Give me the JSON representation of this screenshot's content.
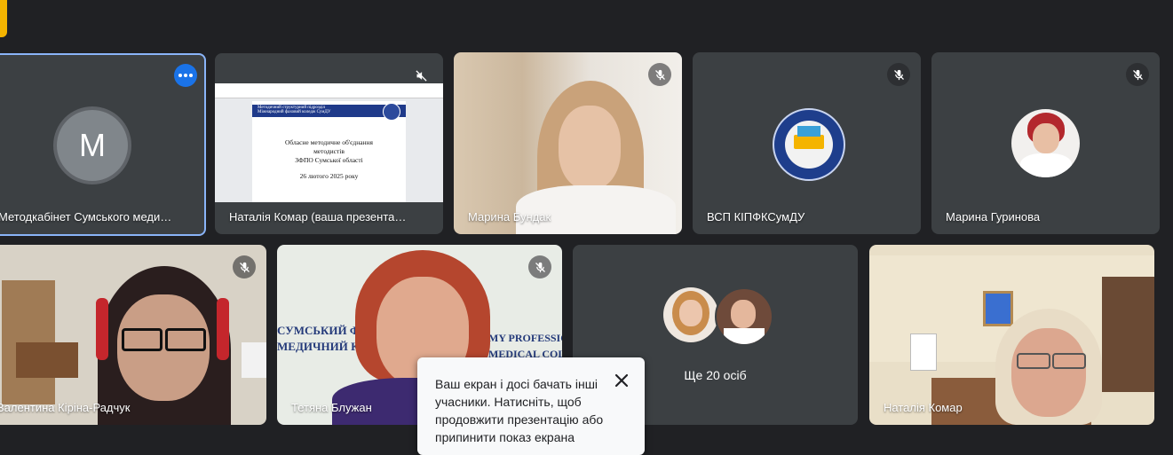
{
  "tiles": [
    {
      "name": "Методкабінет Сумського меди…",
      "avatar_letter": "M"
    },
    {
      "name": "Наталія Комар (ваша презента…",
      "slide_header": "Методичний структурний підрозділ",
      "slide_sub": "Міжнародний фаховий коледж СумДУ",
      "slide_line1": "Обласне методичне об'єднання",
      "slide_line2": "методистів",
      "slide_line3": "ЗФПО Сумської області",
      "slide_date": "26 лютого 2025 року"
    },
    {
      "name": "Марина Бундак"
    },
    {
      "name": "ВСП КІПФКСумДУ"
    },
    {
      "name": "Марина Гуринова"
    },
    {
      "name": "Валентина Кіріна-Радчук"
    },
    {
      "name": "Тетяна Блужан",
      "wall_text1": "СУМСЬКИЙ ФАХО",
      "wall_text2": "МЕДИЧНИЙ КОЛЕ",
      "wall_text3": "MY PROFESSIONAL",
      "wall_text4": "MEDICAL COLLEGE"
    },
    {
      "name": "Ще 20 осіб"
    },
    {
      "name": "Наталія Комар"
    }
  ],
  "toast": {
    "message": "Ваш екран і досі бачать інші учасники. Натисніть, щоб продовжити презентацію або припинити показ екрана"
  },
  "colors": {
    "background": "#202124",
    "tile": "#3c4043",
    "active_border": "#8ab4f8",
    "more_button": "#1a73e8",
    "yellow_accent": "#f4b400"
  }
}
